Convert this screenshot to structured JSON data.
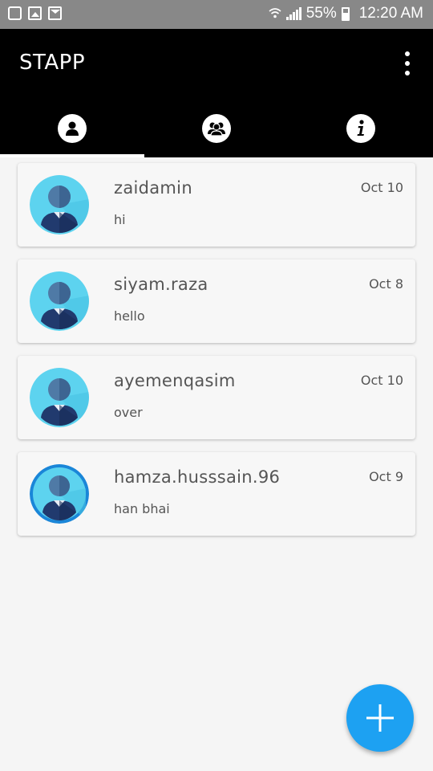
{
  "status": {
    "battery": "55%",
    "time": "12:20 AM",
    "left_icons": [
      "recycle-icon",
      "image-icon",
      "mail-icon"
    ],
    "right_icons": [
      "wifi-icon",
      "signal-icon",
      "battery-icon"
    ]
  },
  "app": {
    "title": "STAPP",
    "menu_icon": "overflow-menu-icon"
  },
  "tabs": [
    {
      "icon": "person-icon",
      "selected": true
    },
    {
      "icon": "group-icon",
      "selected": false
    },
    {
      "icon": "info-icon",
      "selected": false
    }
  ],
  "chats": [
    {
      "name": "zaidamin",
      "message": "hi",
      "date": "Oct 10"
    },
    {
      "name": "siyam.raza",
      "message": "hello",
      "date": "Oct 8"
    },
    {
      "name": "ayemenqasim",
      "message": "over",
      "date": "Oct 10"
    },
    {
      "name": "hamza.husssain.96",
      "message": "han bhai",
      "date": "Oct 9"
    }
  ],
  "fab": {
    "icon": "plus-icon"
  },
  "colors": {
    "status_bar": "#888888",
    "app_bar": "#000000",
    "background": "#f5f5f5",
    "fab": "#1da1f2",
    "avatar_bg": "#5dd3ef",
    "avatar_ring": "#1a86d8"
  }
}
